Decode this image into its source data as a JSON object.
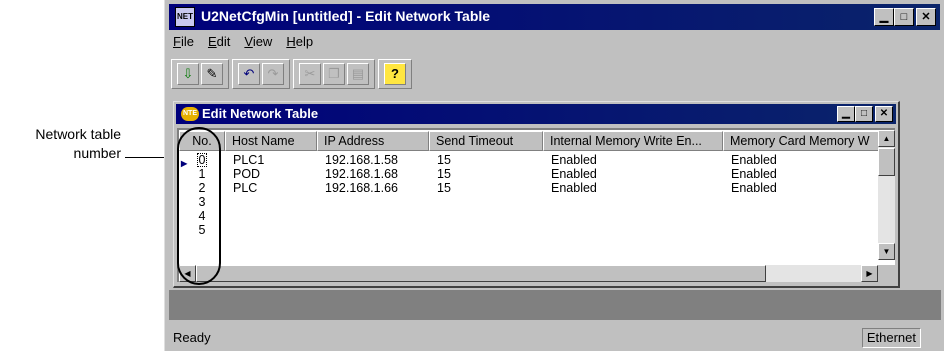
{
  "annotation": {
    "label_line1": "Network table",
    "label_line2": "number"
  },
  "window": {
    "title": "U2NetCfgMin [untitled]  - Edit Network Table",
    "icon_name": "app-icon",
    "min_glyph": "▁",
    "max_glyph": "□",
    "close_glyph": "✕"
  },
  "menu": [
    "File",
    "Edit",
    "View",
    "Help"
  ],
  "toolbar": {
    "buttons": [
      "import-icon",
      "export-icon",
      "undo-icon",
      "redo-icon",
      "cut-icon",
      "copy-icon",
      "paste-icon",
      "help-icon"
    ]
  },
  "child": {
    "title": "Edit Network Table",
    "icon_text": "NTE",
    "columns": [
      "No.",
      "Host Name",
      "IP Address",
      "Send Timeout",
      "Internal Memory Write En...",
      "Memory Card Memory W"
    ],
    "rows": [
      {
        "no": "0",
        "host": "PLC1",
        "ip": "192.168.1.58",
        "timeout": "15",
        "internal": "Enabled",
        "card": "Enabled"
      },
      {
        "no": "1",
        "host": "POD",
        "ip": "192.168.1.68",
        "timeout": "15",
        "internal": "Enabled",
        "card": "Enabled"
      },
      {
        "no": "2",
        "host": "PLC",
        "ip": "192.168.1.66",
        "timeout": "15",
        "internal": "Enabled",
        "card": "Enabled"
      },
      {
        "no": "3",
        "host": "",
        "ip": "",
        "timeout": "",
        "internal": "",
        "card": ""
      },
      {
        "no": "4",
        "host": "",
        "ip": "",
        "timeout": "",
        "internal": "",
        "card": ""
      },
      {
        "no": "5",
        "host": "",
        "ip": "",
        "timeout": "",
        "internal": "",
        "card": ""
      }
    ]
  },
  "status": {
    "text": "Ready",
    "pane": "Ethernet"
  }
}
